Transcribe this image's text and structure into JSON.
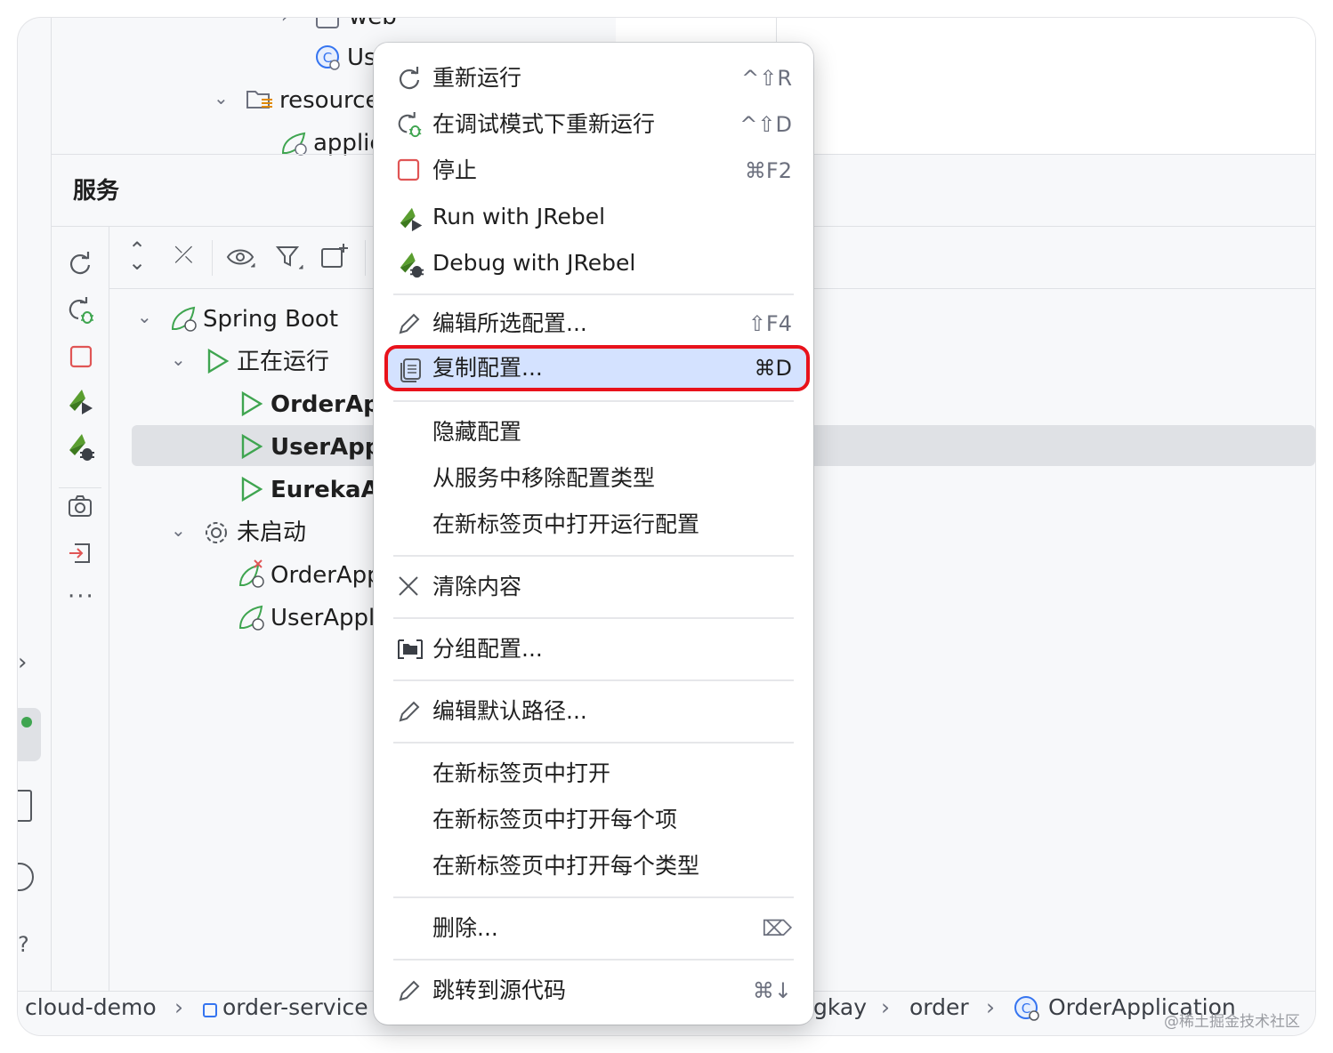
{
  "project_tree": {
    "web": "web",
    "user_class": "Us",
    "resources": "resource",
    "application": "applic"
  },
  "services_panel": {
    "title": "服务",
    "tree": {
      "spring_boot": "Spring Boot",
      "running_group": "正在运行",
      "running_apps": [
        "OrderApp",
        "UserAppl",
        "EurekaAp"
      ],
      "stopped_group": "未启动",
      "stopped_apps": [
        "OrderApp",
        "UserAppli"
      ]
    }
  },
  "context_menu": {
    "items": [
      {
        "label": "重新运行",
        "shortcut": "^⇧R",
        "icon": "rerun-icon"
      },
      {
        "label": "在调试模式下重新运行",
        "shortcut": "^⇧D",
        "icon": "rerun-debug-icon"
      },
      {
        "label": "停止",
        "shortcut": "⌘F2",
        "icon": "stop-icon"
      },
      {
        "label": "Run with JRebel",
        "shortcut": "",
        "icon": "jrebel-run-icon"
      },
      {
        "label": "Debug with JRebel",
        "shortcut": "",
        "icon": "jrebel-debug-icon"
      },
      {
        "label": "编辑所选配置...",
        "shortcut": "⇧F4",
        "icon": "pencil-icon"
      },
      {
        "label": "复制配置...",
        "shortcut": "⌘D",
        "icon": "copy-icon",
        "selected": true
      },
      {
        "label": "隐藏配置",
        "shortcut": ""
      },
      {
        "label": "从服务中移除配置类型",
        "shortcut": ""
      },
      {
        "label": "在新标签页中打开运行配置",
        "shortcut": ""
      },
      {
        "label": "清除内容",
        "shortcut": "",
        "icon": "close-icon"
      },
      {
        "label": "分组配置...",
        "shortcut": "",
        "icon": "folder-group-icon"
      },
      {
        "label": "编辑默认路径...",
        "shortcut": "",
        "icon": "pencil-icon"
      },
      {
        "label": "在新标签页中打开",
        "shortcut": ""
      },
      {
        "label": "在新标签页中打开每个项",
        "shortcut": ""
      },
      {
        "label": "在新标签页中打开每个类型",
        "shortcut": ""
      },
      {
        "label": "删除...",
        "shortcut": "⌦",
        "icon": "delete-key-icon"
      },
      {
        "label": "跳转到源代码",
        "shortcut": "⌘↓",
        "icon": "pencil-icon"
      }
    ]
  },
  "breadcrumb": {
    "items": [
      "cloud-demo",
      "order-service",
      "gkay",
      "order",
      "OrderApplication"
    ]
  },
  "watermark": "@稀土掘金技术社区",
  "colors": {
    "highlight_bg": "#d4e2ff",
    "highlight_border": "#e8121b",
    "run_green": "#3fa550",
    "stop_red": "#e05555",
    "class_blue": "#3574f0"
  }
}
